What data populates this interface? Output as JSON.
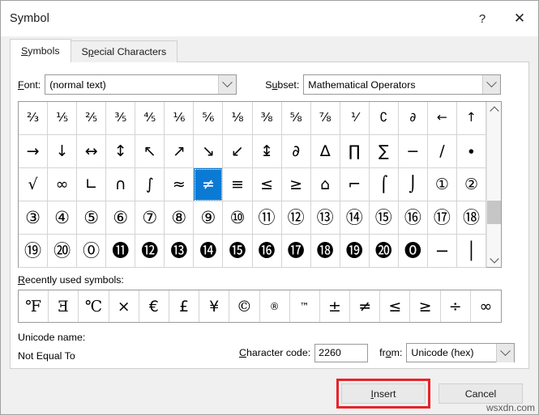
{
  "window": {
    "title": "Symbol",
    "help_label": "?",
    "close_label": "✕"
  },
  "tabs": [
    {
      "label": "Symbols",
      "active": true
    },
    {
      "label": "Special Characters",
      "active": false
    }
  ],
  "fields": {
    "font_label": "Font:",
    "font_value": "(normal text)",
    "subset_label": "Subset:",
    "subset_value": "Mathematical Operators"
  },
  "grid": {
    "selected_index": 38,
    "rows": [
      [
        "⅔",
        "⅕",
        "⅖",
        "⅗",
        "⅘",
        "⅙",
        "⅚",
        "⅛",
        "⅜",
        "⅝",
        "⅞",
        "⅟",
        "∁",
        "∂",
        "←",
        "↑"
      ],
      [
        "→",
        "↓",
        "↔",
        "↕",
        "↖",
        "↗",
        "↘",
        "↙",
        "↨",
        "∂",
        "∆",
        "∏",
        "∑",
        "−",
        "∕",
        "∙"
      ],
      [
        "√",
        "∞",
        "∟",
        "∩",
        "∫",
        "≈",
        "≠",
        "≡",
        "≤",
        "≥",
        "⌂",
        "⌐",
        "⌠",
        "⌡",
        "①",
        "②"
      ],
      [
        "③",
        "④",
        "⑤",
        "⑥",
        "⑦",
        "⑧",
        "⑨",
        "⑩",
        "⑪",
        "⑫",
        "⑬",
        "⑭",
        "⑮",
        "⑯",
        "⑰",
        "⑱"
      ],
      [
        "⑲",
        "⑳",
        "⓪",
        "⓫",
        "⓬",
        "⓭",
        "⓮",
        "⓯",
        "⓰",
        "⓱",
        "⓲",
        "⓳",
        "⓴",
        "⓿",
        "−",
        "│"
      ]
    ]
  },
  "recent": {
    "label": "Recently used symbols:",
    "symbols": [
      "℉",
      "Ǝ",
      "℃",
      "×",
      "€",
      "£",
      "¥",
      "©",
      "®",
      "™",
      "±",
      "≠",
      "≤",
      "≥",
      "÷",
      "∞"
    ]
  },
  "info": {
    "unicode_name_label": "Unicode name:",
    "unicode_name_value": "Not Equal To",
    "charcode_label": "Character code:",
    "charcode_value": "2260",
    "from_label": "from:",
    "from_value": "Unicode (hex)"
  },
  "footer": {
    "insert_label": "Insert",
    "cancel_label": "Cancel",
    "watermark": "wsxdn.com",
    "highlight_color": "#e8222a"
  },
  "colors": {
    "selection": "#0b7ad5",
    "dialog_bg": "#f0f0f0",
    "panel_bg": "#ffffff"
  }
}
